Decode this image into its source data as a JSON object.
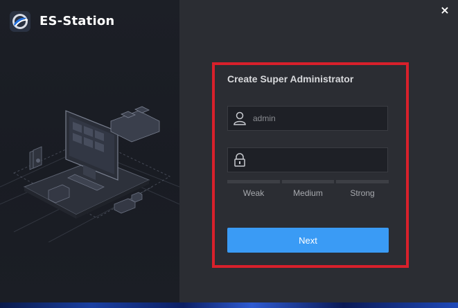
{
  "app": {
    "title": "ES-Station",
    "logo_icon": "es-station-logo"
  },
  "window": {
    "close_glyph": "×"
  },
  "form": {
    "title": "Create Super Administrator",
    "username": {
      "icon": "user-icon",
      "value": "",
      "placeholder": "admin"
    },
    "password": {
      "icon": "lock-icon",
      "value": "",
      "placeholder": ""
    },
    "strength": {
      "levels": [
        "Weak",
        "Medium",
        "Strong"
      ],
      "current_level": 0
    },
    "next_label": "Next"
  },
  "colors": {
    "accent": "#3a9bf5",
    "highlight_frame": "#d8202b",
    "panel_background": "#2b2d33",
    "left_background": "#1b1e25"
  }
}
